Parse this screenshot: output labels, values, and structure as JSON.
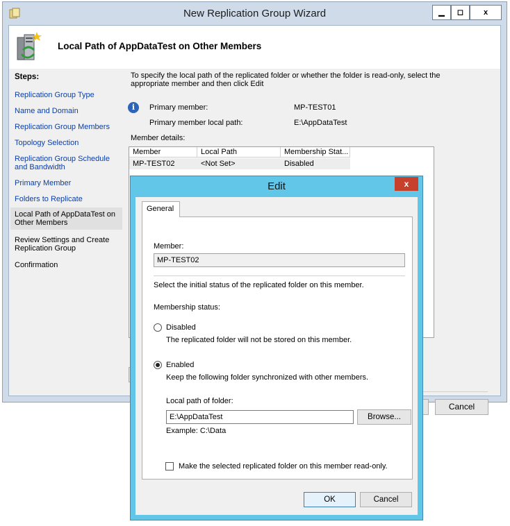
{
  "wizard": {
    "title": "New Replication Group Wizard",
    "header_title": "Local Path of AppDataTest on Other Members",
    "steps_title": "Steps:",
    "steps": [
      "Replication Group Type",
      "Name and Domain",
      "Replication Group Members",
      "Topology Selection",
      "Replication Group Schedule and Bandwidth",
      "Primary Member",
      "Folders to Replicate",
      "Local Path of AppDataTest on Other Members",
      "Review Settings and Create Replication Group",
      "Confirmation"
    ],
    "instructions": "To specify the local path of the replicated folder or whether the folder is read-only, select the appropriate member and then click Edit",
    "primary_member_label": "Primary member:",
    "primary_member_value": "MP-TEST01",
    "primary_path_label": "Primary member local path:",
    "primary_path_value": "E:\\AppDataTest",
    "member_details_label": "Member details:",
    "table": {
      "headers": [
        "Member",
        "Local Path",
        "Membership Stat..."
      ],
      "rows": [
        [
          "MP-TEST02",
          "<Not Set>",
          "Disabled"
        ]
      ]
    },
    "cancel_label": "Cancel"
  },
  "edit": {
    "title": "Edit",
    "close_label": "x",
    "tab_label": "General",
    "member_label": "Member:",
    "member_value": "MP-TEST02",
    "select_status_text": "Select the initial status of the replicated folder on this member.",
    "membership_status_label": "Membership status:",
    "disabled_label": "Disabled",
    "disabled_desc": "The replicated folder will not be stored on this member.",
    "enabled_label": "Enabled",
    "enabled_desc": "Keep the following folder synchronized with other members.",
    "selected_status": "Enabled",
    "local_path_label": "Local path of folder:",
    "local_path_value": "E:\\AppDataTest",
    "browse_label": "Browse...",
    "example_text": "Example: C:\\Data",
    "readonly_label": "Make the selected replicated folder on this member read-only.",
    "readonly_checked": false,
    "ok_label": "OK",
    "cancel_label": "Cancel"
  }
}
